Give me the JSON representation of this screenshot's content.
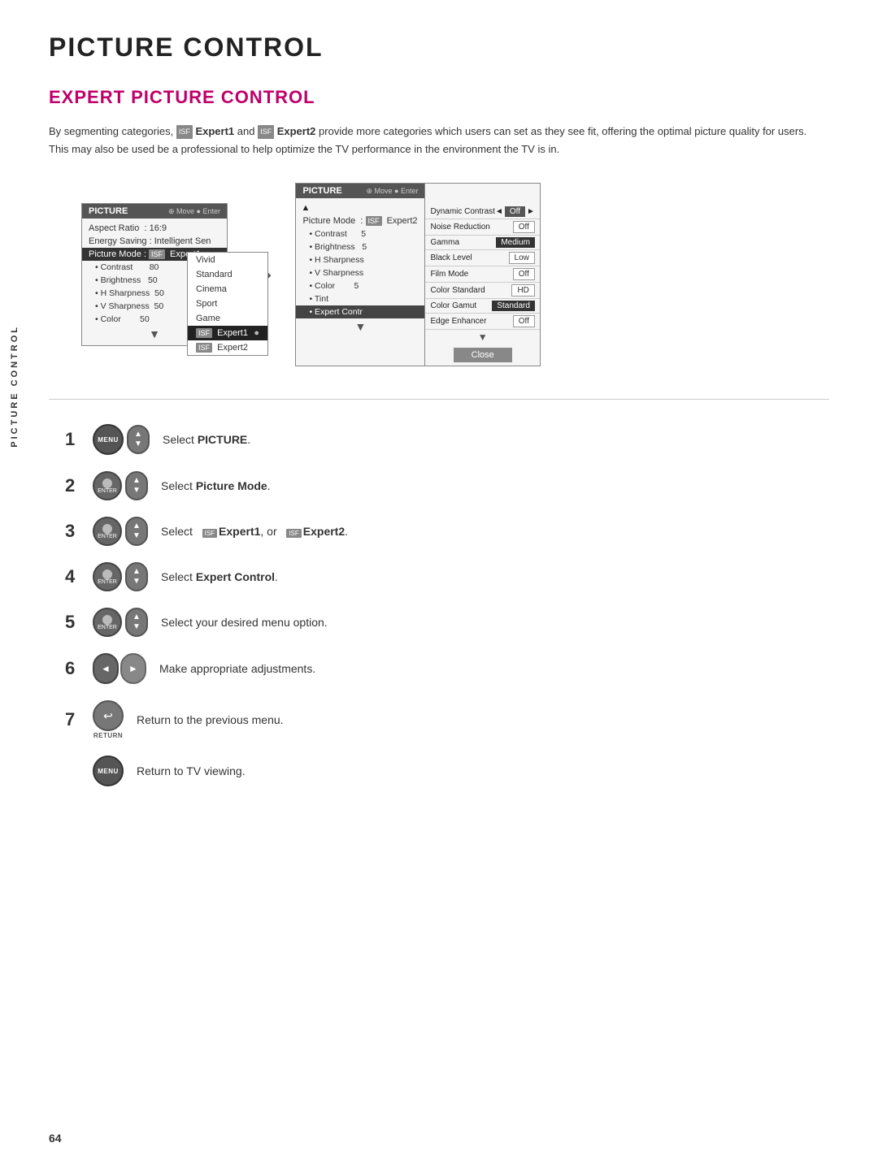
{
  "page": {
    "title": "PICTURE CONTROL",
    "sidebar_label": "PICTURE CONTROL",
    "page_number": "64",
    "section_title": "EXPERT PICTURE CONTROL",
    "intro": {
      "line1": "By segmenting categories,",
      "expert1": "Expert1",
      "and": "and",
      "expert2": "Expert2",
      "line1_end": "provide more categories which users can set as they see fit, offering the optimal picture quality for users.",
      "line2": "This may also be used be a professional to help optimize the TV performance in the environment the TV is in."
    }
  },
  "left_menu": {
    "header": "PICTURE",
    "move_enter": "Move  Enter",
    "rows": [
      {
        "label": "Aspect Ratio",
        "value": ": 16:9"
      },
      {
        "label": "Energy Saving",
        "value": ": Intelligent Sen"
      },
      {
        "label": "Picture Mode",
        "value": ": Expert1",
        "selected": true
      }
    ],
    "sub_rows": [
      {
        "label": "• Contrast",
        "value": "80"
      },
      {
        "label": "• Brightness",
        "value": "50"
      },
      {
        "label": "• H Sharpness",
        "value": "50"
      },
      {
        "label": "• V Sharpness",
        "value": "50"
      },
      {
        "label": "• Color",
        "value": "50"
      }
    ],
    "dropdown": {
      "items": [
        {
          "label": "Vivid"
        },
        {
          "label": "Standard"
        },
        {
          "label": "Cinema"
        },
        {
          "label": "Sport"
        },
        {
          "label": "Game"
        },
        {
          "label": "Expert1",
          "isf": true,
          "highlighted": true
        },
        {
          "label": "Expert2",
          "isf": true
        }
      ]
    }
  },
  "right_menu_left": {
    "header": "PICTURE",
    "move_enter": "Move  Enter",
    "picture_mode_label": "Picture Mode",
    "picture_mode_value": "Expert2",
    "rows": [
      {
        "label": "• Contrast",
        "value": "5"
      },
      {
        "label": "• Brightness",
        "value": "5"
      },
      {
        "label": "• H Sharpness",
        "value": ""
      },
      {
        "label": "• V Sharpness",
        "value": ""
      },
      {
        "label": "• Color",
        "value": "5"
      },
      {
        "label": "• Tint",
        "value": ""
      },
      {
        "label": "• Expert Contr",
        "value": "",
        "selected": true
      }
    ]
  },
  "right_menu_right": {
    "rows": [
      {
        "label": "Dynamic Contrast",
        "value": "Off",
        "has_arrows": true
      },
      {
        "label": "Noise Reduction",
        "value": "Off"
      },
      {
        "label": "Gamma",
        "value": "Medium",
        "highlighted": true
      },
      {
        "label": "Black Level",
        "value": "Low"
      },
      {
        "label": "Film Mode",
        "value": "Off"
      },
      {
        "label": "Color Standard",
        "value": "HD"
      },
      {
        "label": "Color Gamut",
        "value": "Standard",
        "highlighted": true
      },
      {
        "label": "Edge Enhancer",
        "value": "Off"
      },
      {
        "label": "Close",
        "is_button": true
      }
    ]
  },
  "steps": [
    {
      "number": "1",
      "icons": [
        "menu",
        "nav"
      ],
      "text": "Select ",
      "bold": "PICTURE",
      "text_after": "."
    },
    {
      "number": "2",
      "icons": [
        "enter",
        "nav"
      ],
      "text": "Select ",
      "bold": "Picture Mode",
      "text_after": "."
    },
    {
      "number": "3",
      "icons": [
        "enter",
        "nav"
      ],
      "text": "Select",
      "bold": "",
      "text_after": " Expert1, or  Expert2."
    },
    {
      "number": "4",
      "icons": [
        "enter",
        "nav"
      ],
      "text": "Select ",
      "bold": "Expert Control",
      "text_after": "."
    },
    {
      "number": "5",
      "icons": [
        "enter",
        "nav"
      ],
      "text": "Select your desired menu option.",
      "bold": "",
      "text_after": ""
    },
    {
      "number": "6",
      "icons": [
        "left-btn"
      ],
      "text": "Make appropriate adjustments.",
      "bold": "",
      "text_after": ""
    },
    {
      "number": "7",
      "icons": [
        "return"
      ],
      "text": "Return to the previous menu.",
      "bold": "",
      "text_after": ""
    },
    {
      "number": "",
      "icons": [
        "menu-bottom"
      ],
      "text": "Return to TV viewing.",
      "bold": "",
      "text_after": ""
    }
  ]
}
